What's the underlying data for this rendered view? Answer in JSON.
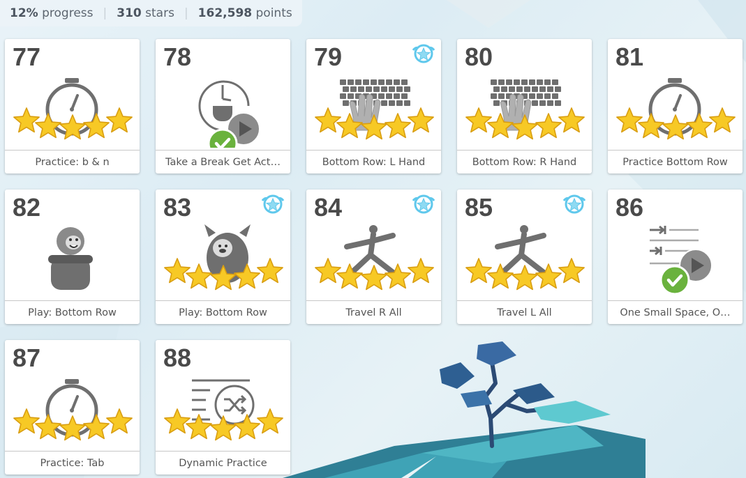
{
  "stats": {
    "progress_value": "12%",
    "progress_label": "progress",
    "stars_value": "310",
    "stars_label": "stars",
    "points_value": "162,598",
    "points_label": "points",
    "separator": "|"
  },
  "lessons": [
    {
      "number": "77",
      "label": "Practice: b & n",
      "icon": "stopwatch-icon",
      "stars": 5,
      "badge": false,
      "completed_check": false
    },
    {
      "number": "78",
      "label": "Take a Break Get Act…",
      "icon": "break-clock-icon",
      "stars": 0,
      "badge": false,
      "completed_check": true
    },
    {
      "number": "79",
      "label": "Bottom Row: L Hand",
      "icon": "keyboard-left-hand-icon",
      "stars": 5,
      "badge": true,
      "completed_check": false
    },
    {
      "number": "80",
      "label": "Bottom Row: R Hand",
      "icon": "keyboard-right-hand-icon",
      "stars": 5,
      "badge": false,
      "completed_check": false
    },
    {
      "number": "81",
      "label": "Practice Bottom Row",
      "icon": "stopwatch-icon",
      "stars": 5,
      "badge": false,
      "completed_check": false
    },
    {
      "number": "82",
      "label": "Play: Bottom Row",
      "icon": "game-character-icon",
      "stars": 0,
      "badge": false,
      "completed_check": false
    },
    {
      "number": "83",
      "label": "Play: Bottom Row",
      "icon": "monster-character-icon",
      "stars": 5,
      "badge": true,
      "completed_check": false
    },
    {
      "number": "84",
      "label": "Travel R All",
      "icon": "yoga-pose-icon",
      "stars": 5,
      "badge": true,
      "completed_check": false
    },
    {
      "number": "85",
      "label": "Travel L All",
      "icon": "yoga-pose-icon",
      "stars": 5,
      "badge": true,
      "completed_check": false
    },
    {
      "number": "86",
      "label": "One Small Space, O…",
      "icon": "tab-lines-icon",
      "stars": 0,
      "badge": false,
      "completed_check": true
    },
    {
      "number": "87",
      "label": "Practice: Tab",
      "icon": "stopwatch-icon",
      "stars": 5,
      "badge": false,
      "completed_check": false
    },
    {
      "number": "88",
      "label": "Dynamic Practice",
      "icon": "shuffle-lines-icon",
      "stars": 5,
      "badge": false,
      "completed_check": false
    }
  ],
  "colors": {
    "star_fill": "#f7c925",
    "star_stroke": "#d99e12",
    "badge_blue": "#5fc8ec",
    "check_green": "#6ab23d",
    "icon_gray": "#6f6f6f",
    "number_text": "#4a4a4a"
  }
}
